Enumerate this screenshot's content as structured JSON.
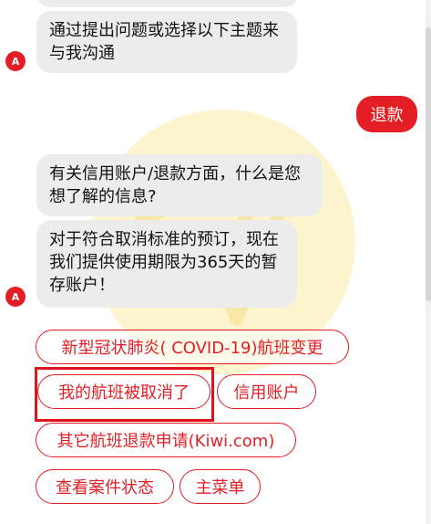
{
  "bot": {
    "avatar_letter": "A",
    "messages": [
      {
        "text": "通过提出问题或选择以下主题来与我沟通"
      },
      {
        "text": "有关信用账户/退款方面，什么是您想了解的信息?"
      },
      {
        "text": "对于符合取消标准的预订，现在我们提供使用期限为365天的暂存账户！"
      }
    ]
  },
  "user": {
    "message": "退款"
  },
  "quick_replies": [
    {
      "label": "新型冠状肺炎( COVID-19)航班变更"
    },
    {
      "label": "我的航班被取消了",
      "highlighted": true
    },
    {
      "label": "信用账户"
    },
    {
      "label": "其它航班退款申请(Kiwi.com)"
    },
    {
      "label": "查看案件状态"
    },
    {
      "label": "主菜单"
    }
  ],
  "colors": {
    "accent": "#e31e24",
    "bubble_bg": "#ececec",
    "highlight_border": "#e0141c",
    "watermark": "#fcf1c0"
  },
  "watermark": {
    "icon": "paper-plane-icon"
  }
}
